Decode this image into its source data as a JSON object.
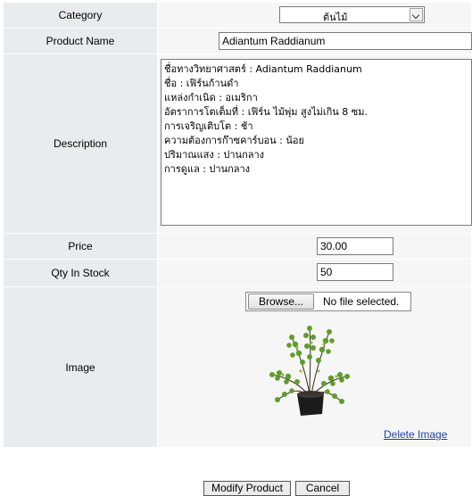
{
  "form": {
    "category": {
      "label": "Category",
      "selected": "ต้นไม้"
    },
    "product_name": {
      "label": "Product Name",
      "value": "Adiantum Raddianum"
    },
    "description": {
      "label": "Description",
      "lines": [
        "ชื่อทางวิทยาศาสตร์ : Adiantum Raddianum",
        "ชื่อ : เฟิร์นก้านดำ",
        "แหล่งกำเนิด : อเมริกา",
        "อัตราการโตเต็มที่ : เฟิร์น ไม้พุ่ม สูงไม่เกิน 8 ซม.",
        "การเจริญเติบโต : ช้า",
        "ความต้องการก๊าซคาร์บอน : น้อย",
        "ปริมาณแสง : ปานกลาง",
        "การดูแล : ปานกลาง"
      ]
    },
    "price": {
      "label": "Price",
      "value": "30.00"
    },
    "qty": {
      "label": "Qty In Stock",
      "value": "50"
    },
    "image": {
      "label": "Image",
      "browse_label": "Browse...",
      "file_status": "No file selected.",
      "delete_label": "Delete Image",
      "icon": "fern-plant-image"
    }
  },
  "actions": {
    "modify_label": "Modify Product",
    "cancel_label": "Cancel"
  },
  "colors": {
    "label_bg": "#e9ebee",
    "value_bg": "#f6f6f6",
    "link": "#1d3fb5"
  }
}
